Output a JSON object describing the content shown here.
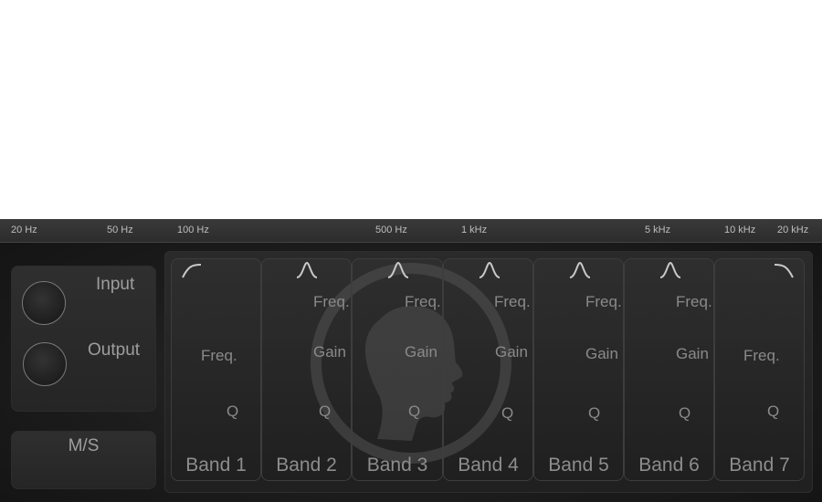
{
  "freq_scale": [
    {
      "label": "20 Hz"
    },
    {
      "label": "50 Hz"
    },
    {
      "label": "100 Hz"
    },
    {
      "label": "500 Hz"
    },
    {
      "label": "1 kHz"
    },
    {
      "label": "5 kHz"
    },
    {
      "label": "10 kHz"
    },
    {
      "label": "20 kHz"
    }
  ],
  "io": {
    "input_label": "Input",
    "output_label": "Output"
  },
  "ms": {
    "label": "M/S"
  },
  "bands": [
    {
      "name": "Band 1",
      "shape": "highpass-icon",
      "freq": "Freq.",
      "q": "Q"
    },
    {
      "name": "Band 2",
      "shape": "bell-icon",
      "freq": "Freq.",
      "gain": "Gain",
      "q": "Q"
    },
    {
      "name": "Band 3",
      "shape": "bell-icon",
      "freq": "Freq.",
      "gain": "Gain",
      "q": "Q"
    },
    {
      "name": "Band 4",
      "shape": "bell-icon",
      "freq": "Freq.",
      "gain": "Gain",
      "q": "Q"
    },
    {
      "name": "Band 5",
      "shape": "bell-icon",
      "freq": "Freq.",
      "gain": "Gain",
      "q": "Q"
    },
    {
      "name": "Band 6",
      "shape": "bell-icon",
      "freq": "Freq.",
      "gain": "Gain",
      "q": "Q"
    },
    {
      "name": "Band 7",
      "shape": "lowpass-icon",
      "freq": "Freq.",
      "q": "Q"
    }
  ]
}
